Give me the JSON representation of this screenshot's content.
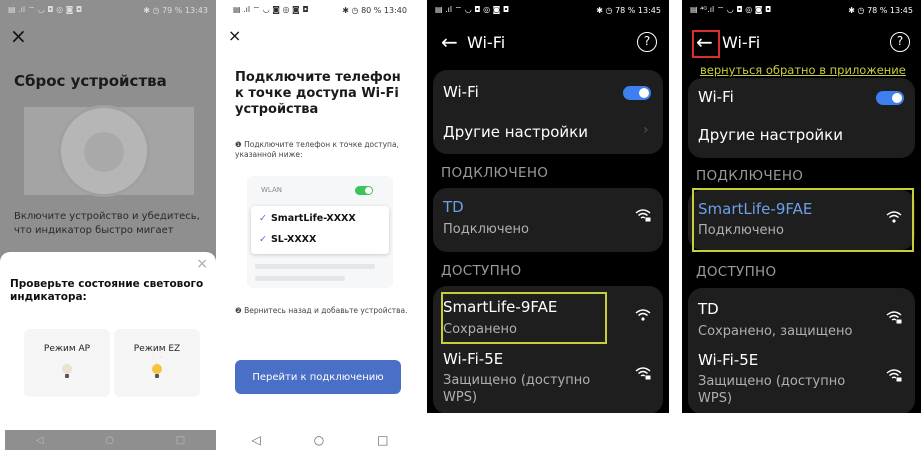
{
  "phone1": {
    "status_left": "▤ .ıl ⌔ ◡ ◘ ◎ ◙ ◘",
    "status_right": "✱ ◷ 79 %  13:43",
    "close_icon": "×",
    "title": "Сброс устройства",
    "instruction": "Включите устройство и убедитесь, что индикатор быстро мигает",
    "sheet": {
      "close_icon": "×",
      "title": "Проверьте состояние светового индикатора:",
      "mode_ap": "Режим AP",
      "mode_ez": "Режим EZ"
    },
    "nav": [
      "◁",
      "○",
      "□"
    ]
  },
  "phone2": {
    "status_left": "▤ .ıl ⌔ ◡ ◙ ◎ ◙ ◘",
    "status_right": "✱ ◷ 80 %  13:40",
    "close_icon": "×",
    "title": "Подключите телефон к точке доступа Wi-Fi устройства",
    "step1": "❶ Подключите телефон к точке доступа, указанной ниже:",
    "wlan_label": "WLAN",
    "net1": "SmartLife-XXXX",
    "net2": "SL-XXXX",
    "check": "✓",
    "step2": "❷ Вернитесь назад и добавьте устройства.",
    "button": "Перейти к подключению",
    "nav": [
      "◁",
      "○",
      "□"
    ]
  },
  "phone3": {
    "status_left": "▤ .ıl ⌔ ◡ ◘ ◎ ◙ ◘",
    "status_right": "✱ ◷ 78 %  13:45",
    "back_icon": "←",
    "title": "Wi-Fi",
    "help_icon": "?",
    "wifi_label": "Wi-Fi",
    "wifi_enabled": true,
    "other_settings": "Другие настройки",
    "chevron": "›",
    "connected_header": "ПОДКЛЮЧЕНО",
    "connected": {
      "name": "TD",
      "status": "Подключено"
    },
    "available_header": "ДОСТУПНО",
    "available": [
      {
        "name": "SmartLife-9FAE",
        "status": "Сохранено"
      },
      {
        "name": "Wi-Fi-5E",
        "status": "Защищено (доступно WPS)"
      }
    ]
  },
  "phone4": {
    "status_left": "▤ ⁴ᴳ.ıl ⌔ ◡ ◘ ◎ ◙ ◘",
    "status_right": "✱ ◷ 78 %  13:45",
    "back_icon": "←",
    "title": "Wi-Fi",
    "help_icon": "?",
    "annotation": "вернуться обратно в приложение",
    "wifi_label": "Wi-Fi",
    "wifi_enabled": true,
    "other_settings": "Другие настройки",
    "connected_header": "ПОДКЛЮЧЕНО",
    "connected": {
      "name": "SmartLife-9FAE",
      "status": "Подключено"
    },
    "available_header": "ДОСТУПНО",
    "available": [
      {
        "name": "TD",
        "status": "Сохранено, защищено"
      },
      {
        "name": "Wi-Fi-5E",
        "status": "Защищено (доступно WPS)"
      }
    ]
  },
  "colors": {
    "accent_blue": "#4a6fc7",
    "highlight_yellow": "#c8cf3a",
    "highlight_red": "#d9302e",
    "connected_name_blue": "#6d9fe8",
    "switch_blue": "#3d7ff0"
  },
  "icons": {
    "wifi_locked": "wifi-lock-icon",
    "wifi_open": "wifi-icon",
    "bulb": "bulb-icon"
  }
}
